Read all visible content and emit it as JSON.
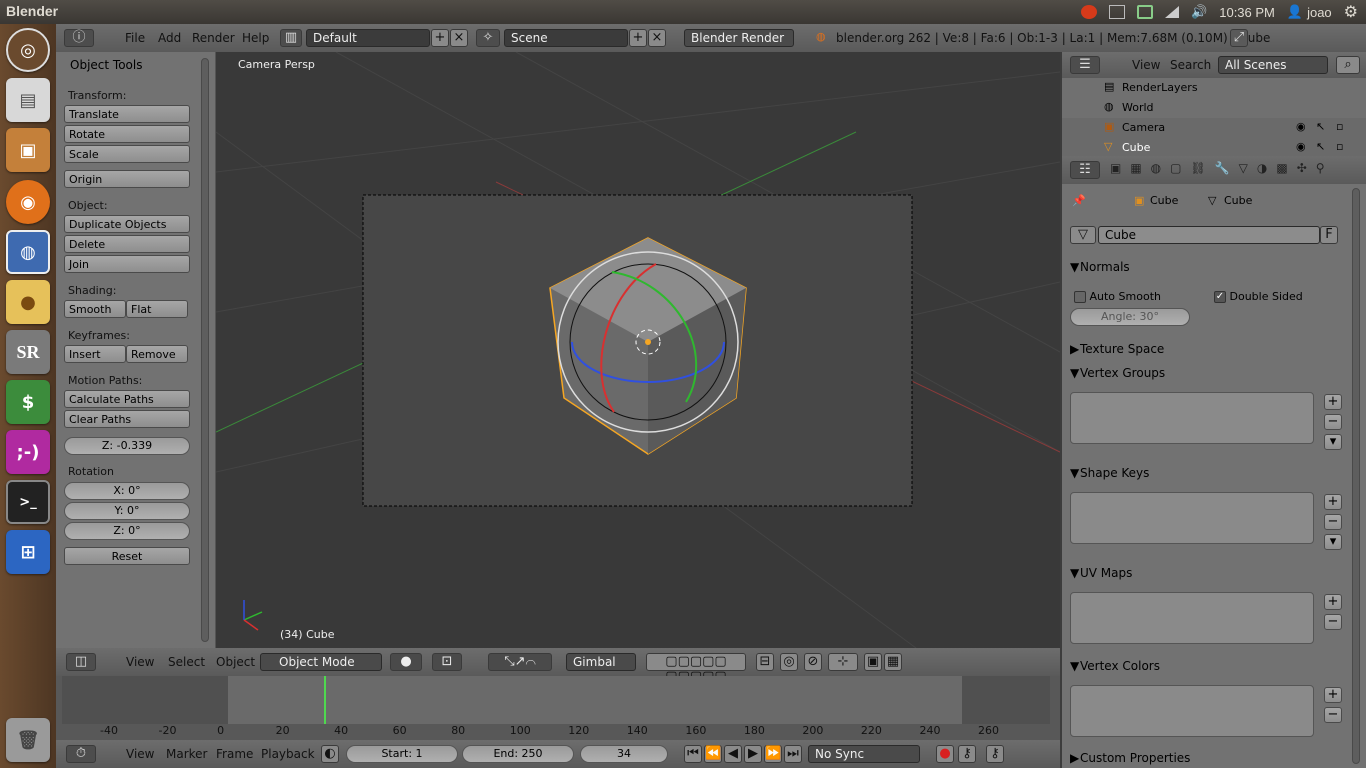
{
  "os": {
    "app_title": "Blender",
    "time": "10:36 PM",
    "user": "joao"
  },
  "info": {
    "file": "File",
    "add": "Add",
    "render": "Render",
    "help": "Help",
    "layout": "Default",
    "scene": "Scene",
    "engine": "Blender Render",
    "stats": "blender.org 262 | Ve:8 | Fa:6 | Ob:1-3 | La:1 | Mem:7.68M (0.10M) | Cube"
  },
  "tools": {
    "title": "Object Tools",
    "transform": "Transform:",
    "translate": "Translate",
    "rotate": "Rotate",
    "scale": "Scale",
    "origin": "Origin",
    "object": "Object:",
    "duplicate": "Duplicate Objects",
    "delete": "Delete",
    "join": "Join",
    "shading": "Shading:",
    "smooth": "Smooth",
    "flat": "Flat",
    "keyframes": "Keyframes:",
    "insert": "Insert",
    "remove": "Remove",
    "motion": "Motion Paths:",
    "calc": "Calculate Paths",
    "clear": "Clear Paths",
    "z_loc": "Z: -0.339",
    "rotation": "Rotation",
    "rx": "X: 0°",
    "ry": "Y: 0°",
    "rz": "Z: 0°",
    "reset": "Reset"
  },
  "viewport": {
    "label": "Camera Persp",
    "object": "(34) Cube"
  },
  "vphdr": {
    "view": "View",
    "select": "Select",
    "object": "Object",
    "mode": "Object Mode",
    "orientation": "Gimbal"
  },
  "timeline": {
    "ticks": [
      "-40",
      "-20",
      "0",
      "20",
      "40",
      "60",
      "80",
      "100",
      "120",
      "140",
      "160",
      "180",
      "200",
      "220",
      "240",
      "260"
    ],
    "current_frame": 34,
    "view": "View",
    "marker": "Marker",
    "frame": "Frame",
    "playback": "Playback",
    "start": "Start: 1",
    "end": "End: 250",
    "frame_value": "34",
    "sync": "No Sync"
  },
  "outliner": {
    "view": "View",
    "search": "Search",
    "filter": "All Scenes",
    "items": [
      "RenderLayers",
      "World",
      "Camera",
      "Cube"
    ]
  },
  "props": {
    "crumb_obj": "Cube",
    "crumb_mesh": "Cube",
    "mesh_name": "Cube",
    "fake_user": "F",
    "normals": "Normals",
    "auto_smooth": "Auto Smooth",
    "double_sided": "Double Sided",
    "angle": "Angle: 30°",
    "texture_space": "Texture Space",
    "vertex_groups": "Vertex Groups",
    "shape_keys": "Shape Keys",
    "uv_maps": "UV Maps",
    "vertex_colors": "Vertex Colors",
    "custom_props": "Custom Properties"
  },
  "colors": {
    "selection": "#f5a623",
    "x_axis": "#d83030",
    "y_axis": "#2fb82f",
    "z_axis": "#3050e0"
  }
}
